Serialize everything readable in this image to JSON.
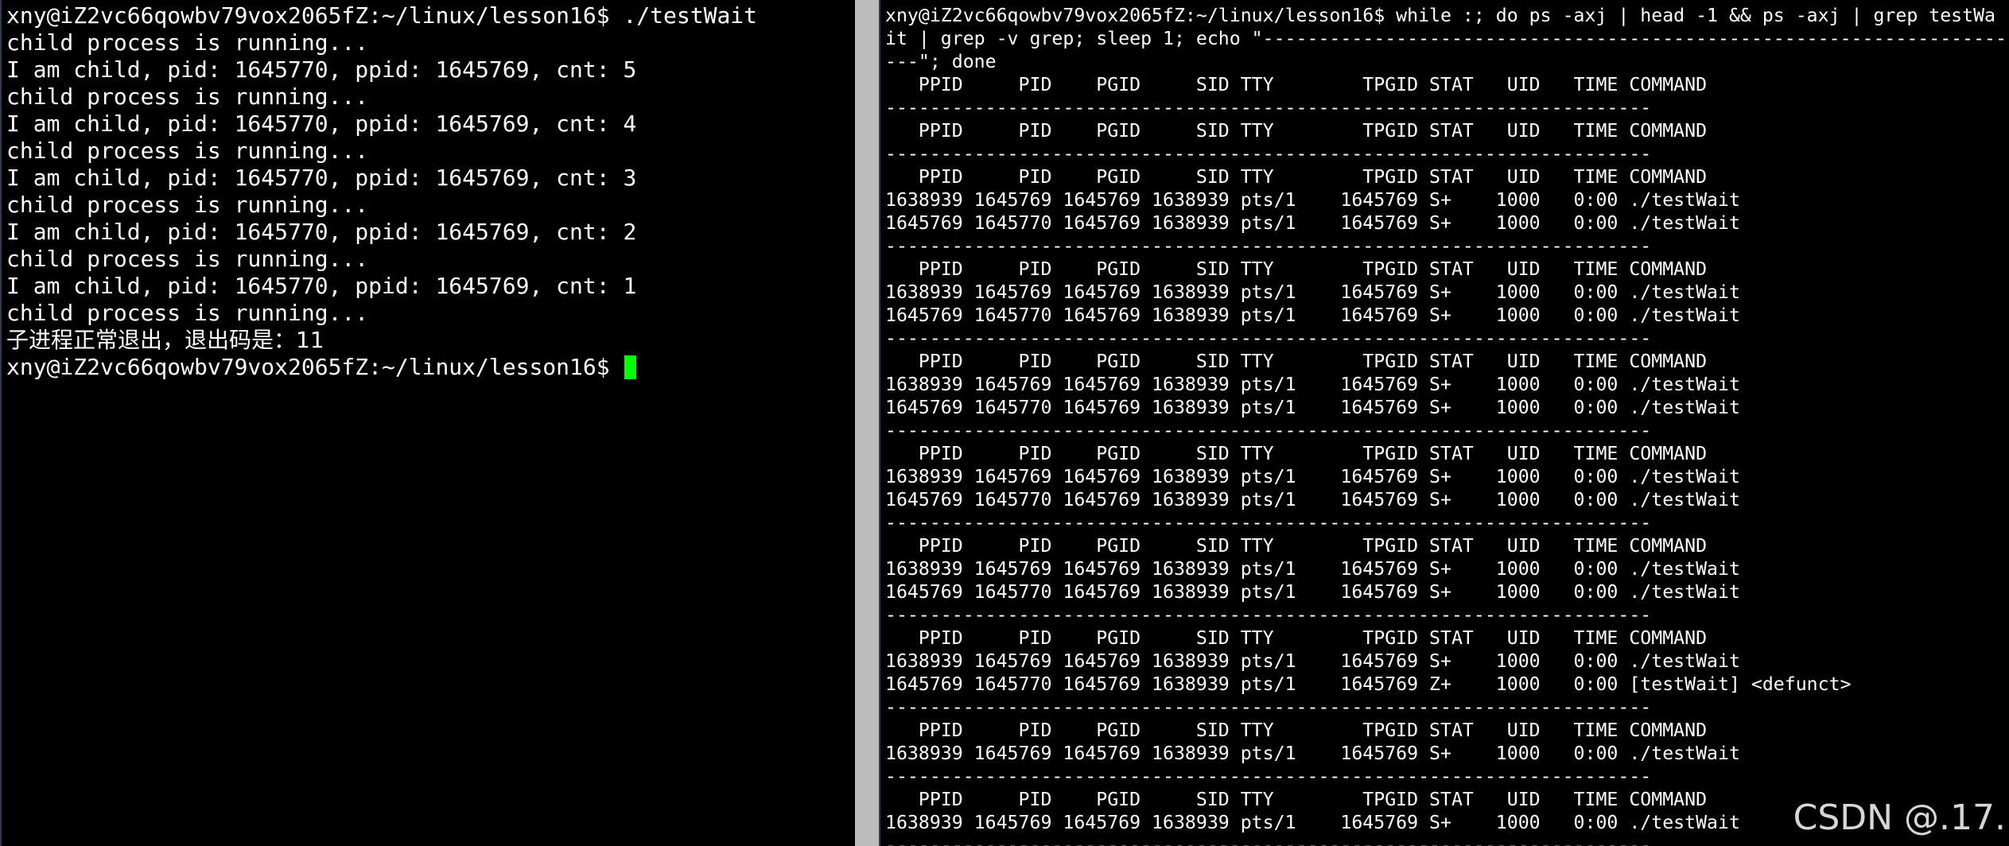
{
  "left": {
    "lines": [
      "xny@iZ2vc66qowbv79vox2065fZ:~/linux/lesson16$ ./testWait",
      "child process is running...",
      "I am child, pid: 1645770, ppid: 1645769, cnt: 5",
      "child process is running...",
      "I am child, pid: 1645770, ppid: 1645769, cnt: 4",
      "child process is running...",
      "I am child, pid: 1645770, ppid: 1645769, cnt: 3",
      "child process is running...",
      "I am child, pid: 1645770, ppid: 1645769, cnt: 2",
      "child process is running...",
      "I am child, pid: 1645770, ppid: 1645769, cnt: 1",
      "child process is running...",
      "子进程正常退出，退出码是：11"
    ],
    "prompt": "xny@iZ2vc66qowbv79vox2065fZ:~/linux/lesson16$ "
  },
  "right": {
    "lines": [
      "xny@iZ2vc66qowbv79vox2065fZ:~/linux/lesson16$ while :; do ps -axj | head -1 && ps -axj | grep testWa",
      "it | grep -v grep; sleep 1; echo \"-----------------------------------------------------------------------",
      "---\"; done",
      "   PPID     PID    PGID     SID TTY        TPGID STAT   UID   TIME COMMAND",
      "---------------------------------------------------------------------",
      "   PPID     PID    PGID     SID TTY        TPGID STAT   UID   TIME COMMAND",
      "---------------------------------------------------------------------",
      "   PPID     PID    PGID     SID TTY        TPGID STAT   UID   TIME COMMAND",
      "1638939 1645769 1645769 1638939 pts/1    1645769 S+    1000   0:00 ./testWait",
      "1645769 1645770 1645769 1638939 pts/1    1645769 S+    1000   0:00 ./testWait",
      "---------------------------------------------------------------------",
      "   PPID     PID    PGID     SID TTY        TPGID STAT   UID   TIME COMMAND",
      "1638939 1645769 1645769 1638939 pts/1    1645769 S+    1000   0:00 ./testWait",
      "1645769 1645770 1645769 1638939 pts/1    1645769 S+    1000   0:00 ./testWait",
      "---------------------------------------------------------------------",
      "   PPID     PID    PGID     SID TTY        TPGID STAT   UID   TIME COMMAND",
      "1638939 1645769 1645769 1638939 pts/1    1645769 S+    1000   0:00 ./testWait",
      "1645769 1645770 1645769 1638939 pts/1    1645769 S+    1000   0:00 ./testWait",
      "---------------------------------------------------------------------",
      "   PPID     PID    PGID     SID TTY        TPGID STAT   UID   TIME COMMAND",
      "1638939 1645769 1645769 1638939 pts/1    1645769 S+    1000   0:00 ./testWait",
      "1645769 1645770 1645769 1638939 pts/1    1645769 S+    1000   0:00 ./testWait",
      "---------------------------------------------------------------------",
      "   PPID     PID    PGID     SID TTY        TPGID STAT   UID   TIME COMMAND",
      "1638939 1645769 1645769 1638939 pts/1    1645769 S+    1000   0:00 ./testWait",
      "1645769 1645770 1645769 1638939 pts/1    1645769 S+    1000   0:00 ./testWait",
      "---------------------------------------------------------------------",
      "   PPID     PID    PGID     SID TTY        TPGID STAT   UID   TIME COMMAND",
      "1638939 1645769 1645769 1638939 pts/1    1645769 S+    1000   0:00 ./testWait",
      "1645769 1645770 1645769 1638939 pts/1    1645769 Z+    1000   0:00 [testWait] <defunct>",
      "---------------------------------------------------------------------",
      "   PPID     PID    PGID     SID TTY        TPGID STAT   UID   TIME COMMAND",
      "1638939 1645769 1645769 1638939 pts/1    1645769 S+    1000   0:00 ./testWait",
      "---------------------------------------------------------------------",
      "   PPID     PID    PGID     SID TTY        TPGID STAT   UID   TIME COMMAND",
      "1638939 1645769 1645769 1638939 pts/1    1645769 S+    1000   0:00 ./testWait",
      "---------------------------------------------------------------------"
    ]
  },
  "watermark": "CSDN @.17.",
  "colors": {
    "background": "#000000",
    "text": "#ffffff",
    "cursor": "#00ff00",
    "divider": "#bcbcbc",
    "watermark": "#d7d7d7"
  },
  "icons": {
    "cursor": "block-cursor-icon"
  }
}
